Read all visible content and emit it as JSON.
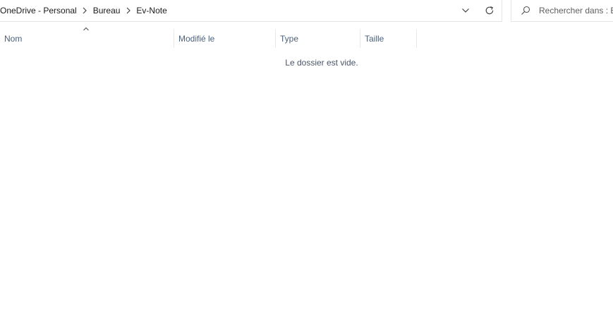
{
  "breadcrumb": {
    "items": [
      {
        "label": "OneDrive - Personal"
      },
      {
        "label": "Bureau"
      },
      {
        "label": "Ev-Note"
      }
    ]
  },
  "address_bar": {
    "dropdown_icon": "chevron-down-icon",
    "refresh_icon": "refresh-icon"
  },
  "search": {
    "icon": "search-icon",
    "placeholder": "Rechercher dans : Ev-Note"
  },
  "columns": {
    "name": "Nom",
    "modified": "Modifié le",
    "type": "Type",
    "size": "Taille",
    "sort_icon": "sort-ascending-icon"
  },
  "content": {
    "empty_message": "Le dossier est vide."
  },
  "colors": {
    "header_text": "#4c607a",
    "divider": "#e5e5e5"
  }
}
